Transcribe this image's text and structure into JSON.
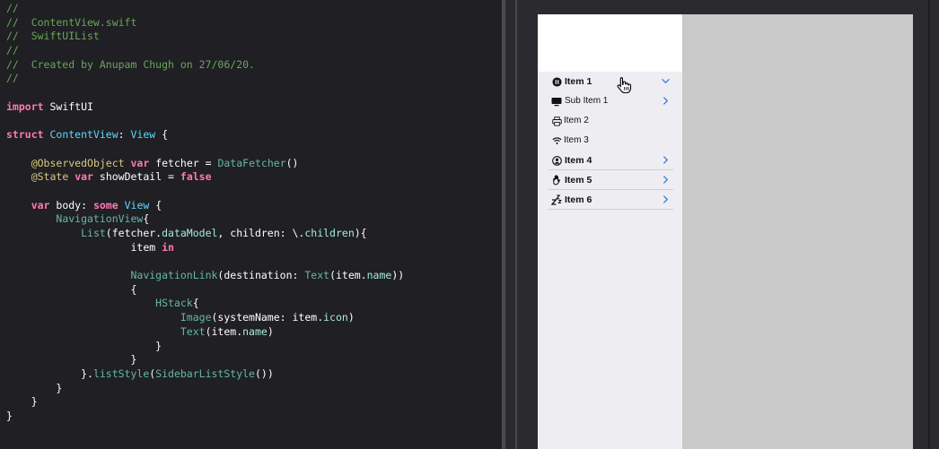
{
  "editor": {
    "lines": [
      [
        {
          "t": "//",
          "c": "comment"
        }
      ],
      [
        {
          "t": "//  ContentView.swift",
          "c": "comment"
        }
      ],
      [
        {
          "t": "//  SwiftUIList",
          "c": "comment"
        }
      ],
      [
        {
          "t": "//",
          "c": "comment"
        }
      ],
      [
        {
          "t": "//  Created by Anupam Chugh on 27/06/20.",
          "c": "comment"
        }
      ],
      [
        {
          "t": "//",
          "c": "comment"
        }
      ],
      [],
      [
        {
          "t": "import",
          "c": "keyword"
        },
        {
          "t": " SwiftUI",
          "c": "plain"
        }
      ],
      [],
      [
        {
          "t": "struct",
          "c": "keyword"
        },
        {
          "t": " ",
          "c": "plain"
        },
        {
          "t": "ContentView",
          "c": "type"
        },
        {
          "t": ": ",
          "c": "plain"
        },
        {
          "t": "View",
          "c": "type"
        },
        {
          "t": " {",
          "c": "plain"
        }
      ],
      [],
      [
        {
          "t": "    ",
          "c": "plain"
        },
        {
          "t": "@ObservedObject",
          "c": "attr"
        },
        {
          "t": " ",
          "c": "plain"
        },
        {
          "t": "var",
          "c": "keyword"
        },
        {
          "t": " fetcher = ",
          "c": "plain"
        },
        {
          "t": "DataFetcher",
          "c": "func"
        },
        {
          "t": "()",
          "c": "plain"
        }
      ],
      [
        {
          "t": "    ",
          "c": "plain"
        },
        {
          "t": "@State",
          "c": "attr"
        },
        {
          "t": " ",
          "c": "plain"
        },
        {
          "t": "var",
          "c": "keyword"
        },
        {
          "t": " showDetail = ",
          "c": "plain"
        },
        {
          "t": "false",
          "c": "bool"
        }
      ],
      [],
      [
        {
          "t": "    ",
          "c": "plain"
        },
        {
          "t": "var",
          "c": "keyword"
        },
        {
          "t": " body: ",
          "c": "plain"
        },
        {
          "t": "some",
          "c": "keyword"
        },
        {
          "t": " ",
          "c": "plain"
        },
        {
          "t": "View",
          "c": "type"
        },
        {
          "t": " {",
          "c": "plain"
        }
      ],
      [
        {
          "t": "        ",
          "c": "plain"
        },
        {
          "t": "NavigationView",
          "c": "func"
        },
        {
          "t": "{",
          "c": "plain"
        }
      ],
      [
        {
          "t": "            ",
          "c": "plain"
        },
        {
          "t": "List",
          "c": "func"
        },
        {
          "t": "(fetcher.",
          "c": "plain"
        },
        {
          "t": "dataModel",
          "c": "prop"
        },
        {
          "t": ", children: \\.",
          "c": "plain"
        },
        {
          "t": "children",
          "c": "prop"
        },
        {
          "t": "){",
          "c": "plain"
        }
      ],
      [
        {
          "t": "                    item ",
          "c": "plain"
        },
        {
          "t": "in",
          "c": "keyword"
        }
      ],
      [],
      [
        {
          "t": "                    ",
          "c": "plain"
        },
        {
          "t": "NavigationLink",
          "c": "func"
        },
        {
          "t": "(destination: ",
          "c": "plain"
        },
        {
          "t": "Text",
          "c": "func"
        },
        {
          "t": "(item.",
          "c": "plain"
        },
        {
          "t": "name",
          "c": "prop"
        },
        {
          "t": "))",
          "c": "plain"
        }
      ],
      [
        {
          "t": "                    {",
          "c": "plain"
        }
      ],
      [
        {
          "t": "                        ",
          "c": "plain"
        },
        {
          "t": "HStack",
          "c": "func"
        },
        {
          "t": "{",
          "c": "plain"
        }
      ],
      [
        {
          "t": "                            ",
          "c": "plain"
        },
        {
          "t": "Image",
          "c": "func"
        },
        {
          "t": "(systemName: item.",
          "c": "plain"
        },
        {
          "t": "icon",
          "c": "prop"
        },
        {
          "t": ")",
          "c": "plain"
        }
      ],
      [
        {
          "t": "                            ",
          "c": "plain"
        },
        {
          "t": "Text",
          "c": "func"
        },
        {
          "t": "(item.",
          "c": "plain"
        },
        {
          "t": "name",
          "c": "prop"
        },
        {
          "t": ")",
          "c": "plain"
        }
      ],
      [
        {
          "t": "                        }",
          "c": "plain"
        }
      ],
      [
        {
          "t": "                    }",
          "c": "plain"
        }
      ],
      [
        {
          "t": "            }.",
          "c": "plain"
        },
        {
          "t": "listStyle",
          "c": "func"
        },
        {
          "t": "(",
          "c": "plain"
        },
        {
          "t": "SidebarListStyle",
          "c": "func"
        },
        {
          "t": "())",
          "c": "plain"
        }
      ],
      [
        {
          "t": "        }",
          "c": "plain"
        }
      ],
      [
        {
          "t": "    }",
          "c": "plain"
        }
      ],
      [
        {
          "t": "}",
          "c": "plain"
        }
      ]
    ]
  },
  "preview": {
    "colors": {
      "accent": "#3a7bd5",
      "sidebar_bg": "#eeeef2",
      "detail_bg": "#c9c9c9"
    },
    "rows": [
      {
        "label": "Item 1",
        "icon": "pause-circle-icon",
        "level": 0,
        "bold": true,
        "chevron": "chevron-down-icon",
        "separator": false
      },
      {
        "label": "Sub Item 1",
        "icon": "display-icon",
        "level": 1,
        "bold": false,
        "chevron": "chevron-right-icon",
        "separator": false
      },
      {
        "label": "Item 2",
        "icon": "printer-icon",
        "level": 2,
        "bold": false,
        "chevron": "",
        "separator": false
      },
      {
        "label": "Item 3",
        "icon": "wifi-icon",
        "level": 2,
        "bold": false,
        "chevron": "",
        "separator": false
      },
      {
        "label": "Item 4",
        "icon": "person-circle-icon",
        "level": 0,
        "bold": true,
        "chevron": "chevron-right-icon",
        "separator": true
      },
      {
        "label": "Item 5",
        "icon": "hand-icon",
        "level": 0,
        "bold": true,
        "chevron": "chevron-right-icon",
        "separator": true
      },
      {
        "label": "Item 6",
        "icon": "zzz-icon",
        "level": 0,
        "bold": true,
        "chevron": "chevron-right-icon",
        "separator": true
      }
    ]
  }
}
